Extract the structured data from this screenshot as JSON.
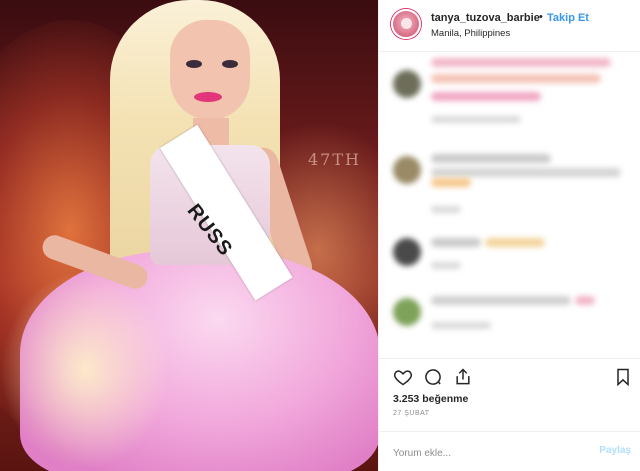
{
  "post": {
    "username": "tanya_tuzova_barbie",
    "separator": "•",
    "follow_label": "Takip Et",
    "location": "Manila, Philippines",
    "likes": "3.253 beğenme",
    "date": "27 ŞUBAT",
    "comment_placeholder": "Yorum ekle...",
    "post_label": "Paylaş",
    "sash_text": "RUSS",
    "stage_text": "47TH"
  },
  "icons": {
    "like": "heart-icon",
    "comment": "speech-bubble-icon",
    "share": "share-icon",
    "save": "bookmark-icon"
  },
  "colors": {
    "accent": "#3897f0",
    "text": "#262626",
    "muted": "#8e8e8e",
    "border": "#efefef"
  }
}
